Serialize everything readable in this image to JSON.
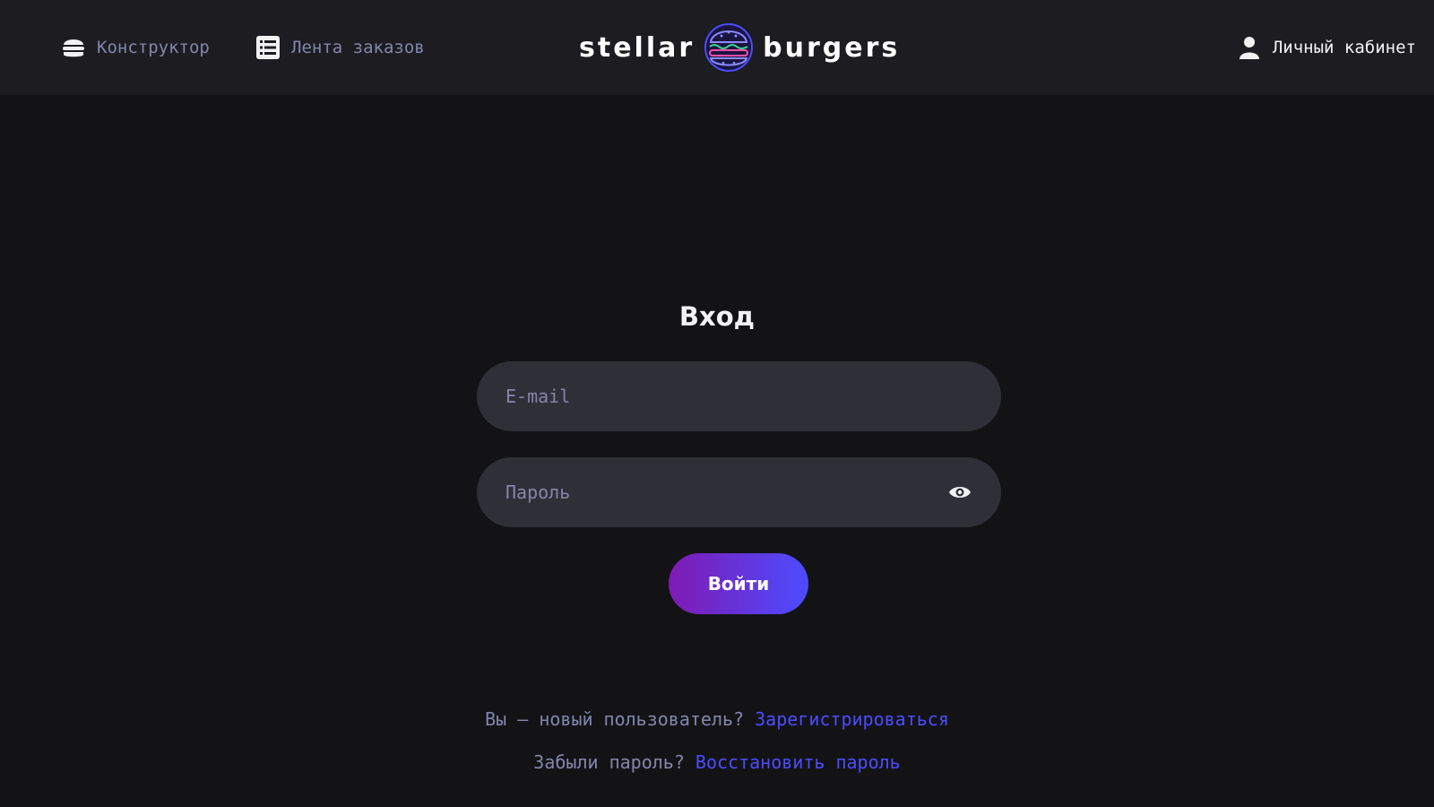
{
  "header": {
    "nav": {
      "constructor_label": "Конструктор",
      "feed_label": "Лента заказов",
      "account_label": "Личный кабинет"
    },
    "logo": {
      "left_word": "stellar",
      "right_word": "burgers"
    }
  },
  "login": {
    "title": "Вход",
    "email_placeholder": "E-mail",
    "password_placeholder": "Пароль",
    "submit_label": "Войти",
    "new_user_text": "Вы — новый пользователь?",
    "register_link": "Зарегистрироваться",
    "forgot_text": "Забыли пароль?",
    "restore_link": "Восстановить пароль"
  },
  "colors": {
    "background": "#131316",
    "header": "#1c1c21",
    "input": "#2f2f37",
    "inactive_text": "#8585ad",
    "accent": "#4c4cff",
    "button_gradient_start": "#801ab2"
  },
  "icons": {
    "constructor": "burger-icon",
    "feed": "list-icon",
    "account": "profile-icon",
    "password_toggle": "eye-icon"
  }
}
